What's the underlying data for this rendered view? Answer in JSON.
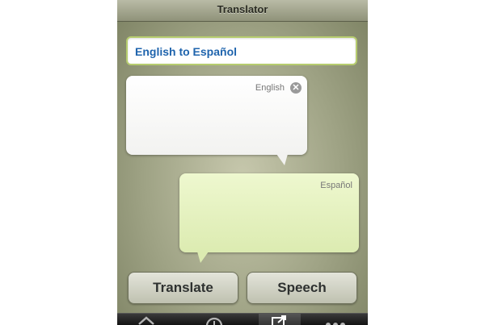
{
  "navbar": {
    "title": "Translator"
  },
  "language_selector": {
    "value": "English to Español"
  },
  "source_bubble": {
    "language_label": "English",
    "text": "",
    "clear_icon_glyph": "✕"
  },
  "target_bubble": {
    "language_label": "Español",
    "text": ""
  },
  "buttons": {
    "translate_label": "Translate",
    "speech_label": "Speech"
  },
  "tabbar": {
    "tabs": [
      {
        "icon": "home-icon",
        "selected": false
      },
      {
        "icon": "clock-icon",
        "selected": false
      },
      {
        "icon": "translate-icon",
        "selected": true
      },
      {
        "icon": "more-icon",
        "selected": false
      }
    ]
  },
  "colors": {
    "accent_text": "#1f64ad",
    "target_bubble": "#e6f3c1",
    "selector_border": "#b6cc6e"
  }
}
